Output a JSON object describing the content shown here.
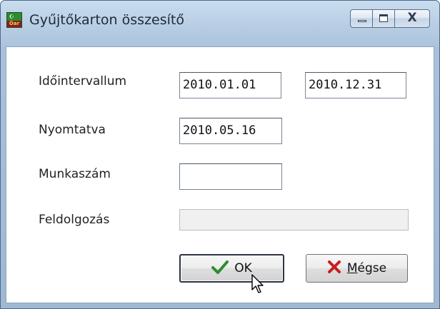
{
  "window": {
    "title": "Gyűjtőkarton összesítő",
    "app_icon": "app-logo-icon",
    "icon_band_text": "Öar",
    "icon_moon_glyph": "☪",
    "buttons": {
      "minimize": "minimize-icon",
      "maximize": "maximize-icon",
      "close_glyph": "X"
    }
  },
  "form": {
    "period": {
      "label": "Időintervallum",
      "from": "2010.01.01",
      "to": "2010.12.31"
    },
    "printed": {
      "label": "Nyomtatva",
      "value": "2010.05.16"
    },
    "job_number": {
      "label": "Munkaszám",
      "value": ""
    },
    "processing": {
      "label": "Feldolgozás",
      "progress": 0
    }
  },
  "actions": {
    "ok": {
      "label": "OK",
      "icon": "checkmark-icon",
      "color": "#2e8b2e"
    },
    "cancel": {
      "label_first": "M",
      "label_rest": "égse",
      "icon": "x-mark-icon",
      "color": "#c81e1e"
    }
  },
  "cursor": "arrow-cursor-icon"
}
